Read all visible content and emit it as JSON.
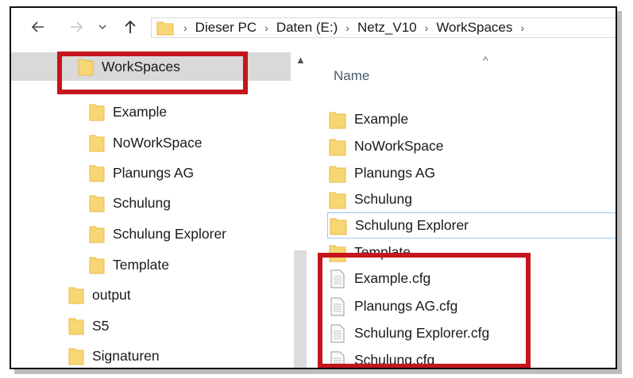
{
  "colors": {
    "highlight": "#c4161c",
    "folder": "#f7d674",
    "folder_dark": "#e8b94a",
    "selected_bg": "#d9d9d9",
    "header_text": "#4b5a6b"
  },
  "toolbar": {
    "back_icon": "arrow-left-icon",
    "forward_icon": "arrow-right-icon",
    "recent_icon": "chevron-down-icon",
    "up_icon": "arrow-up-icon"
  },
  "address": {
    "crumbs": [
      "Dieser PC",
      "Daten (E:)",
      "Netz_V10",
      "WorkSpaces"
    ],
    "separator": "›"
  },
  "tree": {
    "items": [
      {
        "label": "WorkSpaces",
        "selected": true
      },
      {
        "label": "Example"
      },
      {
        "label": "NoWorkSpace"
      },
      {
        "label": "Planungs AG"
      },
      {
        "label": "Schulung"
      },
      {
        "label": "Schulung Explorer"
      },
      {
        "label": "Template"
      },
      {
        "label": "output"
      },
      {
        "label": "S5"
      },
      {
        "label": "Signaturen"
      }
    ]
  },
  "filelist": {
    "column_name": "Name",
    "folders": [
      "Example",
      "NoWorkSpace",
      "Planungs AG",
      "Schulung",
      "Schulung Explorer",
      "Template"
    ],
    "files": [
      "Example.cfg",
      "Planungs AG.cfg",
      "Schulung Explorer.cfg",
      "Schulung.cfg"
    ]
  }
}
